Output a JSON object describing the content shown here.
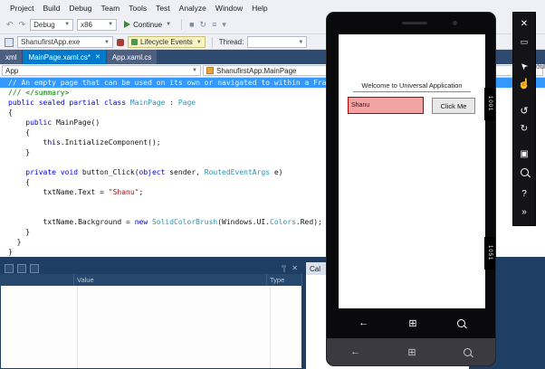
{
  "window": {
    "menu_items": [
      "Project",
      "Build",
      "Debug",
      "Team",
      "Tools",
      "Test",
      "Analyze",
      "Window",
      "Help"
    ],
    "right_edge_fragment": "out"
  },
  "toolbar": {
    "debug_combo": "Debug",
    "platform_combo": "x86",
    "continue_label": "Continue",
    "process_combo": "ShanufirstApp.exe",
    "lifecycle_combo": "Lifecycle Events",
    "thread_label": "Thread:"
  },
  "tabs": {
    "doc_tabs": [
      {
        "label": "xml",
        "active": false
      },
      {
        "label": "MainPage.xaml.cs*",
        "active": true
      },
      {
        "label": "App.xaml.cs",
        "active": false
      }
    ]
  },
  "navbar": {
    "type_combo": "App",
    "member_combo": "ShanufirstApp.MainPage"
  },
  "editor": {
    "lines": [
      {
        "selected": true,
        "tokens": [
          {
            "c": "comment",
            "t": "// An empty page that can be used on its own or navigated to within a Fra"
          }
        ]
      },
      {
        "tokens": [
          {
            "c": "comment",
            "t": "/// </summary>"
          }
        ]
      },
      {
        "tokens": [
          {
            "c": "keyword",
            "t": "public sealed partial class"
          },
          {
            "c": "plain",
            "t": " "
          },
          {
            "c": "type",
            "t": "MainPage"
          },
          {
            "c": "plain",
            "t": " : "
          },
          {
            "c": "type",
            "t": "Page"
          }
        ]
      },
      {
        "tokens": [
          {
            "c": "plain",
            "t": "{"
          }
        ]
      },
      {
        "tokens": [
          {
            "c": "plain",
            "t": "    "
          },
          {
            "c": "keyword",
            "t": "public"
          },
          {
            "c": "plain",
            "t": " MainPage()"
          }
        ]
      },
      {
        "tokens": [
          {
            "c": "plain",
            "t": "    {"
          }
        ]
      },
      {
        "tokens": [
          {
            "c": "plain",
            "t": "        "
          },
          {
            "c": "keyword",
            "t": "this"
          },
          {
            "c": "plain",
            "t": ".InitializeComponent();"
          }
        ]
      },
      {
        "tokens": [
          {
            "c": "plain",
            "t": "    }"
          }
        ]
      },
      {
        "tokens": [
          {
            "c": "plain",
            "t": ""
          }
        ]
      },
      {
        "tokens": [
          {
            "c": "plain",
            "t": "    "
          },
          {
            "c": "keyword",
            "t": "private"
          },
          {
            "c": "plain",
            "t": " "
          },
          {
            "c": "keyword",
            "t": "void"
          },
          {
            "c": "plain",
            "t": " button_Click("
          },
          {
            "c": "keyword",
            "t": "object"
          },
          {
            "c": "plain",
            "t": " sender, "
          },
          {
            "c": "type",
            "t": "RoutedEventArgs"
          },
          {
            "c": "plain",
            "t": " e)"
          }
        ]
      },
      {
        "tokens": [
          {
            "c": "plain",
            "t": "    {"
          }
        ]
      },
      {
        "tokens": [
          {
            "c": "plain",
            "t": "        txtName.Text = "
          },
          {
            "c": "string",
            "t": "\"Shanu\""
          },
          {
            "c": "plain",
            "t": ";"
          }
        ]
      },
      {
        "tokens": [
          {
            "c": "plain",
            "t": ""
          }
        ]
      },
      {
        "tokens": [
          {
            "c": "plain",
            "t": ""
          }
        ]
      },
      {
        "tokens": [
          {
            "c": "plain",
            "t": "        txtName.Background = "
          },
          {
            "c": "keyword",
            "t": "new"
          },
          {
            "c": "plain",
            "t": " "
          },
          {
            "c": "type",
            "t": "SolidColorBrush"
          },
          {
            "c": "plain",
            "t": "(Windows.UI."
          },
          {
            "c": "type",
            "t": "Colors"
          },
          {
            "c": "plain",
            "t": ".Red);"
          }
        ]
      },
      {
        "tokens": [
          {
            "c": "plain",
            "t": "    }"
          }
        ]
      },
      {
        "tokens": [
          {
            "c": "plain",
            "t": "  }"
          }
        ]
      },
      {
        "tokens": [
          {
            "c": "plain",
            "t": "}"
          }
        ]
      }
    ]
  },
  "watch_panel": {
    "columns": [
      "Value",
      "Type"
    ]
  },
  "right_panel": {
    "title": "Cal"
  },
  "icons": {
    "back": "←",
    "windows": "⊞"
  },
  "emulator": {
    "app": {
      "title": "Welcome to Universal Application",
      "textbox_value": "Shanu",
      "button_label": "Click Me"
    },
    "edge_tabs": {
      "top": "1001",
      "bottom": "1051"
    },
    "toolbar": [
      {
        "name": "close",
        "glyph": "✕"
      },
      {
        "name": "minimize",
        "glyph": "▭"
      },
      {
        "name": "pointer",
        "glyph": "➤"
      },
      {
        "name": "hand",
        "glyph": "☝"
      },
      {
        "name": "rotate-left",
        "glyph": "↺"
      },
      {
        "name": "rotate-right",
        "glyph": "↻"
      },
      {
        "name": "fit-to-screen",
        "glyph": "▣"
      },
      {
        "name": "zoom",
        "glyph": "zoom"
      },
      {
        "name": "help",
        "glyph": "?"
      },
      {
        "name": "expand",
        "glyph": "»"
      }
    ]
  },
  "colors": {
    "accent_blue": "#007acc",
    "selection_blue": "#3399ff",
    "panel_navy": "#1f3e63",
    "textbox_fill": "#f2a3a3",
    "textbox_border": "#b50000",
    "lifecycle_highlight": "#f7f3c3"
  }
}
